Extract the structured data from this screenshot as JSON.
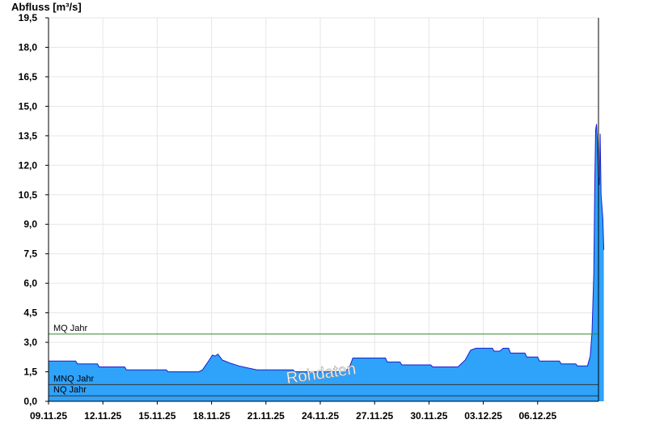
{
  "chart_data": {
    "type": "area",
    "ylabel": "Abfluss [m³/s]",
    "watermark": "Rohdaten",
    "ylim": [
      0,
      19.5
    ],
    "y_ticks": [
      "0,0",
      "1,5",
      "3,0",
      "4,5",
      "6,0",
      "7,5",
      "9,0",
      "10,5",
      "12,0",
      "13,5",
      "15,0",
      "16,5",
      "18,0",
      "19,5"
    ],
    "x_ticks": [
      "09.11.25",
      "12.11.25",
      "15.11.25",
      "18.11.25",
      "21.11.25",
      "24.11.25",
      "27.11.25",
      "30.11.25",
      "03.12.25",
      "06.12.25"
    ],
    "x_range_days": [
      0,
      30.6
    ],
    "grid": true,
    "fill_color": "#2fa2fa",
    "line_color": "#1c1ccf",
    "reference_lines": [
      {
        "name": "MQ Jahr",
        "value": 3.42,
        "color": "#2e8b2e"
      },
      {
        "name": "MNQ Jahr",
        "value": 0.85,
        "color": "#333333"
      },
      {
        "name": "NQ Jahr",
        "value": 0.28,
        "color": "#333333"
      }
    ],
    "series": [
      {
        "points": [
          [
            0.0,
            2.05
          ],
          [
            1.5,
            2.05
          ],
          [
            1.6,
            1.9
          ],
          [
            2.7,
            1.9
          ],
          [
            2.8,
            1.75
          ],
          [
            4.2,
            1.75
          ],
          [
            4.3,
            1.6
          ],
          [
            6.5,
            1.6
          ],
          [
            6.6,
            1.5
          ],
          [
            8.3,
            1.5
          ],
          [
            8.5,
            1.6
          ],
          [
            8.8,
            2.0
          ],
          [
            9.05,
            2.35
          ],
          [
            9.2,
            2.3
          ],
          [
            9.35,
            2.4
          ],
          [
            9.6,
            2.1
          ],
          [
            10.0,
            1.95
          ],
          [
            10.5,
            1.8
          ],
          [
            11.0,
            1.7
          ],
          [
            11.5,
            1.6
          ],
          [
            13.5,
            1.6
          ],
          [
            13.6,
            1.5
          ],
          [
            16.0,
            1.5
          ],
          [
            16.4,
            1.55
          ],
          [
            16.6,
            1.7
          ],
          [
            16.8,
            2.2
          ],
          [
            18.6,
            2.2
          ],
          [
            18.7,
            2.0
          ],
          [
            19.4,
            2.0
          ],
          [
            19.5,
            1.85
          ],
          [
            21.1,
            1.85
          ],
          [
            21.2,
            1.75
          ],
          [
            22.6,
            1.75
          ],
          [
            23.0,
            2.1
          ],
          [
            23.3,
            2.6
          ],
          [
            23.6,
            2.7
          ],
          [
            24.5,
            2.7
          ],
          [
            24.6,
            2.55
          ],
          [
            24.9,
            2.55
          ],
          [
            25.1,
            2.7
          ],
          [
            25.4,
            2.7
          ],
          [
            25.5,
            2.45
          ],
          [
            26.3,
            2.45
          ],
          [
            26.4,
            2.25
          ],
          [
            27.0,
            2.25
          ],
          [
            27.1,
            2.05
          ],
          [
            28.2,
            2.05
          ],
          [
            28.3,
            1.9
          ],
          [
            29.1,
            1.9
          ],
          [
            29.2,
            1.8
          ],
          [
            29.75,
            1.8
          ],
          [
            29.9,
            2.3
          ],
          [
            30.0,
            3.5
          ],
          [
            30.1,
            6.5
          ],
          [
            30.15,
            11.0
          ],
          [
            30.2,
            13.8
          ],
          [
            30.25,
            14.1
          ],
          [
            30.3,
            13.2
          ],
          [
            30.35,
            11.5
          ],
          [
            30.4,
            11.0
          ],
          [
            30.45,
            13.6
          ],
          [
            30.5,
            10.5
          ],
          [
            30.6,
            9.3
          ],
          [
            30.65,
            7.7
          ]
        ]
      }
    ]
  }
}
